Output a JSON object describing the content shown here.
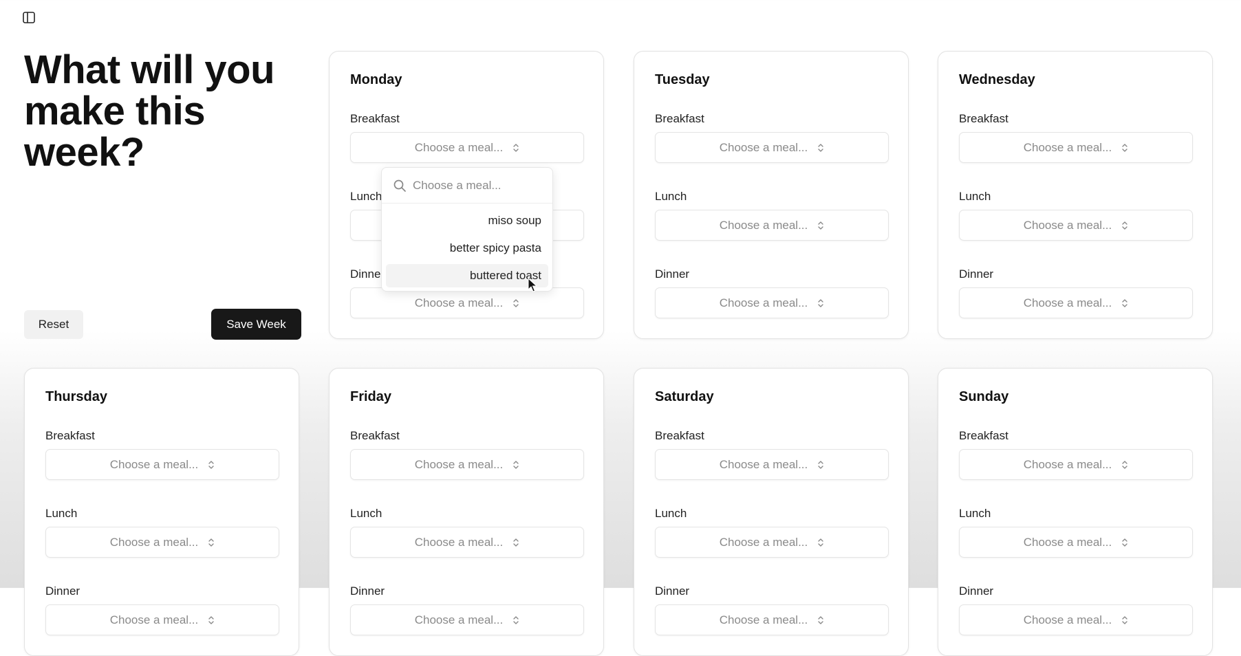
{
  "header": {
    "sidebar_toggle_icon": "sidebar-panel-icon",
    "title": "What will you make this week?"
  },
  "actions": {
    "reset_label": "Reset",
    "save_label": "Save Week"
  },
  "meal_types": [
    "Breakfast",
    "Lunch",
    "Dinner"
  ],
  "select_placeholder": "Choose a meal...",
  "days": [
    {
      "name": "Monday",
      "breakfast_label": "Breakfast",
      "breakfast_value": "Choose a meal...",
      "lunch_label": "Lunch",
      "lunch_value": "Choose a meal...",
      "dinner_label": "Dinner",
      "dinner_value": "Choose a meal..."
    },
    {
      "name": "Tuesday",
      "breakfast_label": "Breakfast",
      "breakfast_value": "Choose a meal...",
      "lunch_label": "Lunch",
      "lunch_value": "Choose a meal...",
      "dinner_label": "Dinner",
      "dinner_value": "Choose a meal..."
    },
    {
      "name": "Wednesday",
      "breakfast_label": "Breakfast",
      "breakfast_value": "Choose a meal...",
      "lunch_label": "Lunch",
      "lunch_value": "Choose a meal...",
      "dinner_label": "Dinner",
      "dinner_value": "Choose a meal..."
    },
    {
      "name": "Thursday",
      "breakfast_label": "Breakfast",
      "breakfast_value": "Choose a meal...",
      "lunch_label": "Lunch",
      "lunch_value": "Choose a meal...",
      "dinner_label": "Dinner",
      "dinner_value": "Choose a meal..."
    },
    {
      "name": "Friday",
      "breakfast_label": "Breakfast",
      "breakfast_value": "Choose a meal...",
      "lunch_label": "Lunch",
      "lunch_value": "Choose a meal...",
      "dinner_label": "Dinner",
      "dinner_value": "Choose a meal..."
    },
    {
      "name": "Saturday",
      "breakfast_label": "Breakfast",
      "breakfast_value": "Choose a meal...",
      "lunch_label": "Lunch",
      "lunch_value": "Choose a meal...",
      "dinner_label": "Dinner",
      "dinner_value": "Choose a meal..."
    },
    {
      "name": "Sunday",
      "breakfast_label": "Breakfast",
      "breakfast_value": "Choose a meal...",
      "lunch_label": "Lunch",
      "lunch_value": "Choose a meal...",
      "dinner_label": "Dinner",
      "dinner_value": "Choose a meal..."
    }
  ],
  "dropdown": {
    "open_for": "Monday Breakfast",
    "search_placeholder": "Choose a meal...",
    "search_icon": "search-icon",
    "options": [
      "miso soup",
      "better spicy pasta",
      "buttered toast"
    ],
    "hovered_option": "buttered toast"
  },
  "colors": {
    "save_button_bg": "#181818",
    "card_border": "#e2e2e2",
    "placeholder_text": "#8a8a8a"
  }
}
